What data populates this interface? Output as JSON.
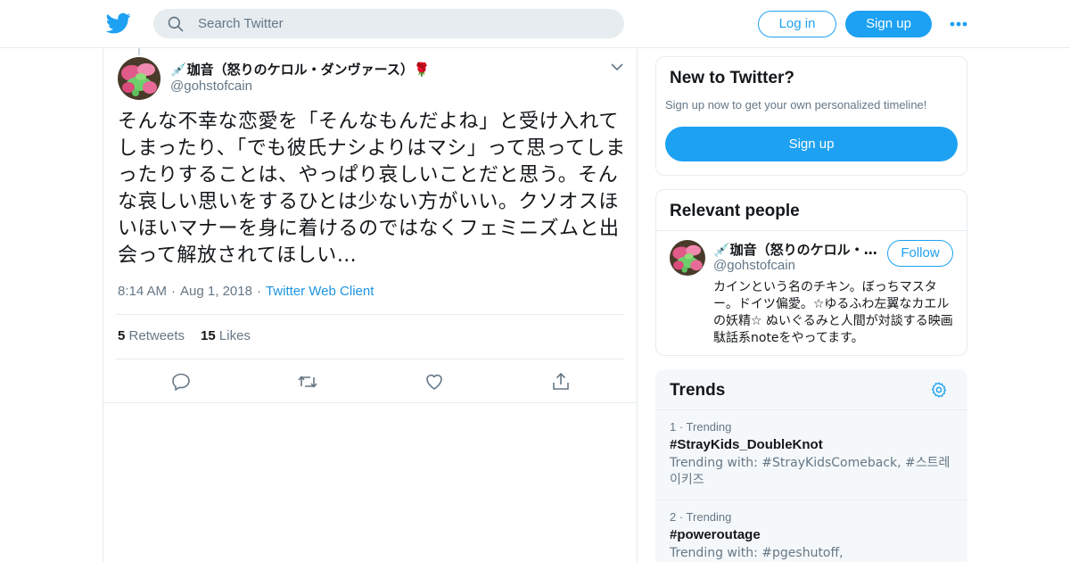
{
  "header": {
    "logo_icon": "twitter-bird-icon",
    "search_placeholder": "Search Twitter",
    "login_label": "Log in",
    "signup_label": "Sign up",
    "more_icon": "more-dots-icon",
    "brand_color": "#1da1f2"
  },
  "tweet": {
    "display_name": "💉珈音（怒りのケロル・ダンヴァース）🌹",
    "username": "@gohstofcain",
    "text": "そんな不幸な恋愛を「そんなもんだよね」と受け入れてしまったり、「でも彼氏ナシよりはマシ」って思ってしまったりすることは、やっぱり哀しいことだと思う。そんな哀しい思いをするひとは少ない方がいい。クソオスほいほいマナーを身に着けるのではなくフェミニズムと出会って解放されてほしい…",
    "time": "8:14 AM",
    "date": "Aug 1, 2018",
    "client": "Twitter Web Client",
    "retweets_count": "5",
    "retweets_label": "Retweets",
    "likes_count": "15",
    "likes_label": "Likes"
  },
  "sidebar": {
    "new_title": "New to Twitter?",
    "new_sub": "Sign up now to get your own personalized timeline!",
    "new_signup": "Sign up",
    "relevant_title": "Relevant people",
    "relevant_person": {
      "name": "💉珈音（怒りのケロル・ダンヴァース）🌹",
      "handle": "@gohstofcain",
      "follow_label": "Follow",
      "bio": "カインという名のチキン。ぼっちマスター。ドイツ偏愛。☆ゆるふわ左翼なカエルの妖精☆ ぬいぐるみと人間が対談する映画駄話系noteをやってます。"
    },
    "trends_title": "Trends",
    "trends": [
      {
        "rank": "1 · Trending",
        "name": "#StrayKids_DoubleKnot",
        "with": "Trending with: #StrayKidsComeback, #스트레이키즈"
      },
      {
        "rank": "2 · Trending",
        "name": "#poweroutage",
        "with": "Trending with: #pgeshutoff,"
      }
    ]
  }
}
